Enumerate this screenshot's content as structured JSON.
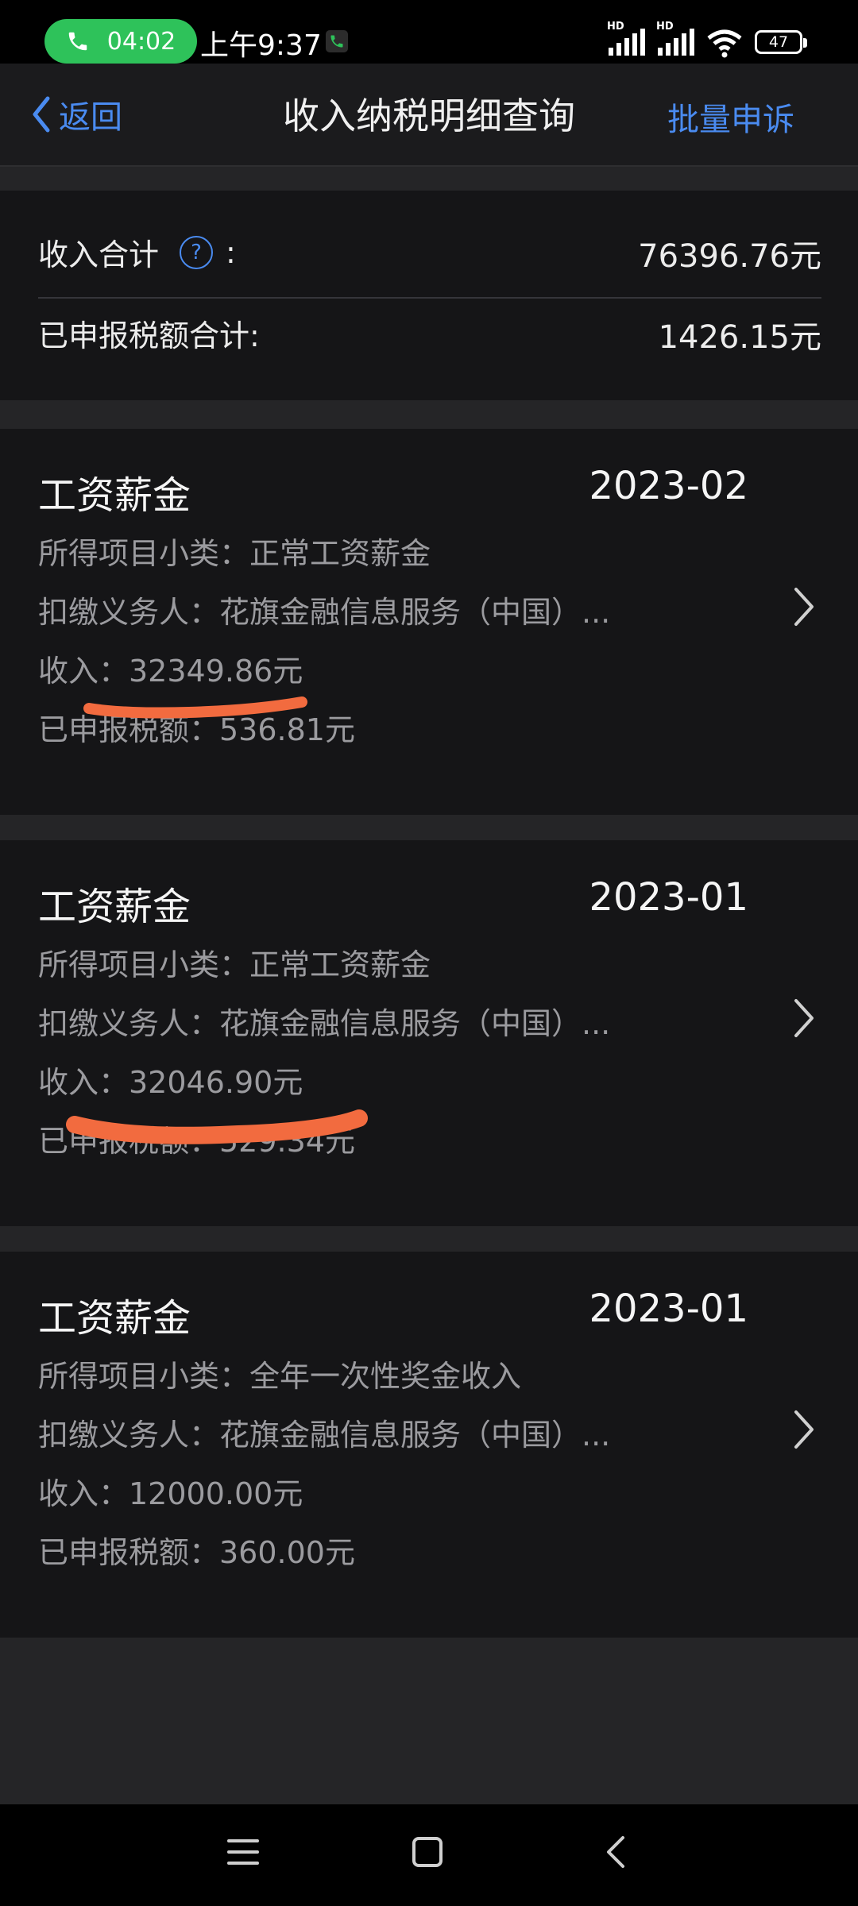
{
  "status_bar": {
    "call_timer": "04:02",
    "time": "上午9:37",
    "signal_1": "HD",
    "signal_2": "HD",
    "battery": "47"
  },
  "nav": {
    "back_label": "返回",
    "title": "收入纳税明细查询",
    "action_label": "批量申诉"
  },
  "summary": {
    "income_label": "收入合计",
    "income_colon": ":",
    "income_value": "76396.76元",
    "tax_label": "已申报税额合计:",
    "tax_value": "1426.15元",
    "help_icon": "?"
  },
  "records": [
    {
      "type": "工资薪金",
      "date": "2023-02",
      "subcategory": "所得项目小类：正常工资薪金",
      "withholder": "扣缴义务人：花旗金融信息服务（中国）...",
      "income": "收入：32349.86元",
      "tax": "已申报税额：536.81元"
    },
    {
      "type": "工资薪金",
      "date": "2023-01",
      "subcategory": "所得项目小类：正常工资薪金",
      "withholder": "扣缴义务人：花旗金融信息服务（中国）...",
      "income": "收入：32046.90元",
      "tax": "已申报税额：529.34元"
    },
    {
      "type": "工资薪金",
      "date": "2023-01",
      "subcategory": "所得项目小类：全年一次性奖金收入",
      "withholder": "扣缴义务人：花旗金融信息服务（中国）...",
      "income": "收入：12000.00元",
      "tax": "已申报税额：360.00元"
    }
  ],
  "colors": {
    "accent": "#4a8bf0",
    "call_green": "#2ec25a",
    "annotation_orange": "#f26b3f"
  },
  "icons": {
    "back": "chevron-left-icon",
    "help": "question-circle-icon",
    "record_arrow": "chevron-right-icon",
    "menu": "menu-icon",
    "home": "home-square-icon",
    "system_back": "system-back-icon"
  }
}
